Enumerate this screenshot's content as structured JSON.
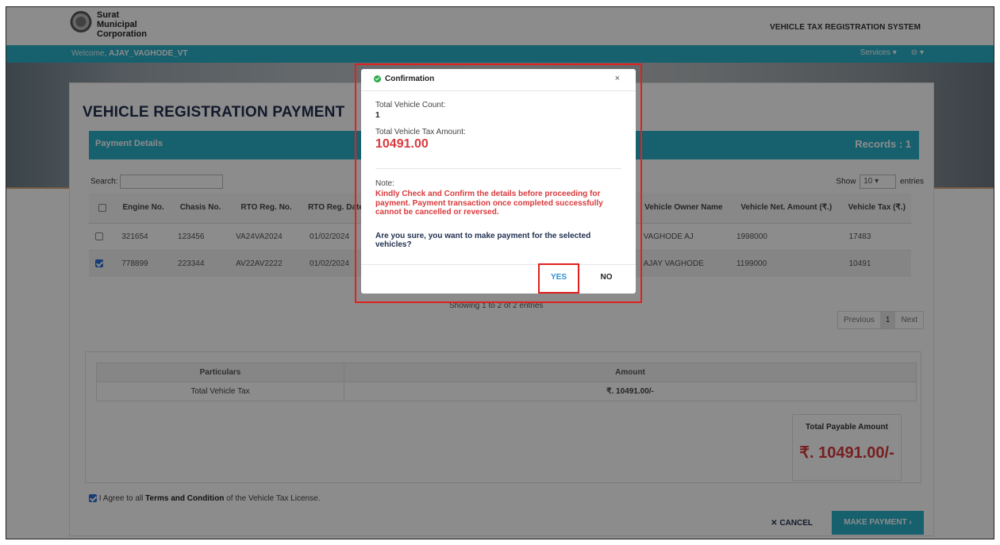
{
  "header": {
    "logo_lines": [
      "Surat",
      "Municipal",
      "Corporation"
    ],
    "system_title": "VEHICLE TAX REGISTRATION SYSTEM",
    "welcome_prefix": "Welcome,",
    "welcome_user": "AJAY_VAGHODE_VT",
    "services_label": "Services",
    "accent": "#2ab0c8"
  },
  "page": {
    "title": "VEHICLE REGISTRATION PAYMENT",
    "panel_title": "Payment Details",
    "records_label": "Records : 1",
    "search_label": "Search:",
    "show_label": "Show",
    "show_value": "10",
    "entries_label": "entries",
    "showing_text": "Showing 1 to 2 of 2 entries",
    "pager": [
      "Previous",
      "1",
      "Next"
    ]
  },
  "table": {
    "columns": [
      "Engine No.",
      "Chasis No.",
      "RTO Reg. No.",
      "RTO Reg. Date",
      "Vehicle Owner Name",
      "Vehicle Net. Amount (₹.)",
      "Vehicle Tax (₹.)"
    ],
    "rows": [
      {
        "checked": false,
        "engine": "321654",
        "chasis": "123456",
        "rto_no": "VA24VA2024",
        "rto_date": "01/02/2024",
        "owner": "VAGHODE AJ",
        "net_amount": "1998000",
        "tax": "17483"
      },
      {
        "checked": true,
        "engine": "778899",
        "chasis": "223344",
        "rto_no": "AV22AV2222",
        "rto_date": "01/02/2024",
        "owner": "AJAY VAGHODE",
        "net_amount": "1199000",
        "tax": "10491"
      }
    ]
  },
  "summary": {
    "col_particulars": "Particulars",
    "col_amount": "Amount",
    "row_label": "Total Vehicle Tax",
    "row_amount": "₹. 10491.00/-",
    "total_label": "Total Payable Amount",
    "total_amount": "₹. 10491.00/-"
  },
  "agree": {
    "prefix": "I Agree to all",
    "link": "Terms and Condition",
    "suffix": "of the Vehicle Tax License."
  },
  "actions": {
    "cancel": "CANCEL",
    "pay": "MAKE PAYMENT"
  },
  "modal": {
    "title": "Confirmation",
    "close": "×",
    "count_label": "Total Vehicle Count:",
    "count_value": "1",
    "tax_label": "Total Vehicle Tax Amount:",
    "tax_value": "10491.00",
    "note_label": "Note:",
    "note_text": "Kindly Check and Confirm the details before proceeding for payment. Payment transaction once completed successfully cannot be cancelled or reversed.",
    "question": "Are you sure, you want to make payment for the selected vehicles?",
    "yes": "YES",
    "no": "NO"
  }
}
